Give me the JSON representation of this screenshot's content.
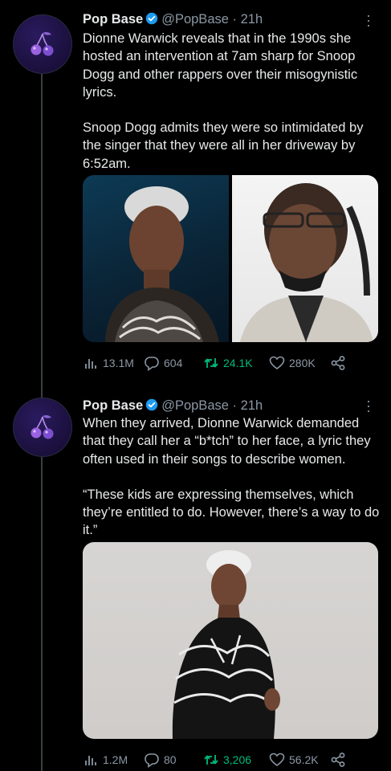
{
  "tweets": [
    {
      "display_name": "Pop Base",
      "handle": "@PopBase",
      "time": "· 21h",
      "paragraphs": [
        "Dionne Warwick reveals that in the 1990s she hosted an intervention at 7am sharp for Snoop Dogg and other rappers over their misogynistic lyrics.",
        "Snoop Dogg admits they were so intimidated by the singer that they were all in her driveway by 6:52am."
      ],
      "stats": {
        "views": "13.1M",
        "replies": "604",
        "retweets": "24.1K",
        "likes": "280K"
      }
    },
    {
      "display_name": "Pop Base",
      "handle": "@PopBase",
      "time": "· 21h",
      "paragraphs": [
        "When they arrived, Dionne Warwick demanded that they call her a “b*tch” to her face, a lyric they often used in their songs to describe women.",
        "“These kids are expressing themselves, which they’re entitled to do. However, there’s a way to do it.”"
      ],
      "stats": {
        "views": "1.2M",
        "replies": "80",
        "retweets": "3,206",
        "likes": "56.2K"
      }
    }
  ],
  "colors": {
    "background": "#000000",
    "text": "#e7e9ea",
    "muted": "#8b98a5",
    "verified": "#1d9bf0",
    "retweet_active": "#00ba7c"
  },
  "icons": [
    "cherry-logo-icon",
    "verified-badge-icon",
    "more-icon",
    "views-icon",
    "reply-icon",
    "retweet-icon",
    "like-icon",
    "share-icon"
  ]
}
